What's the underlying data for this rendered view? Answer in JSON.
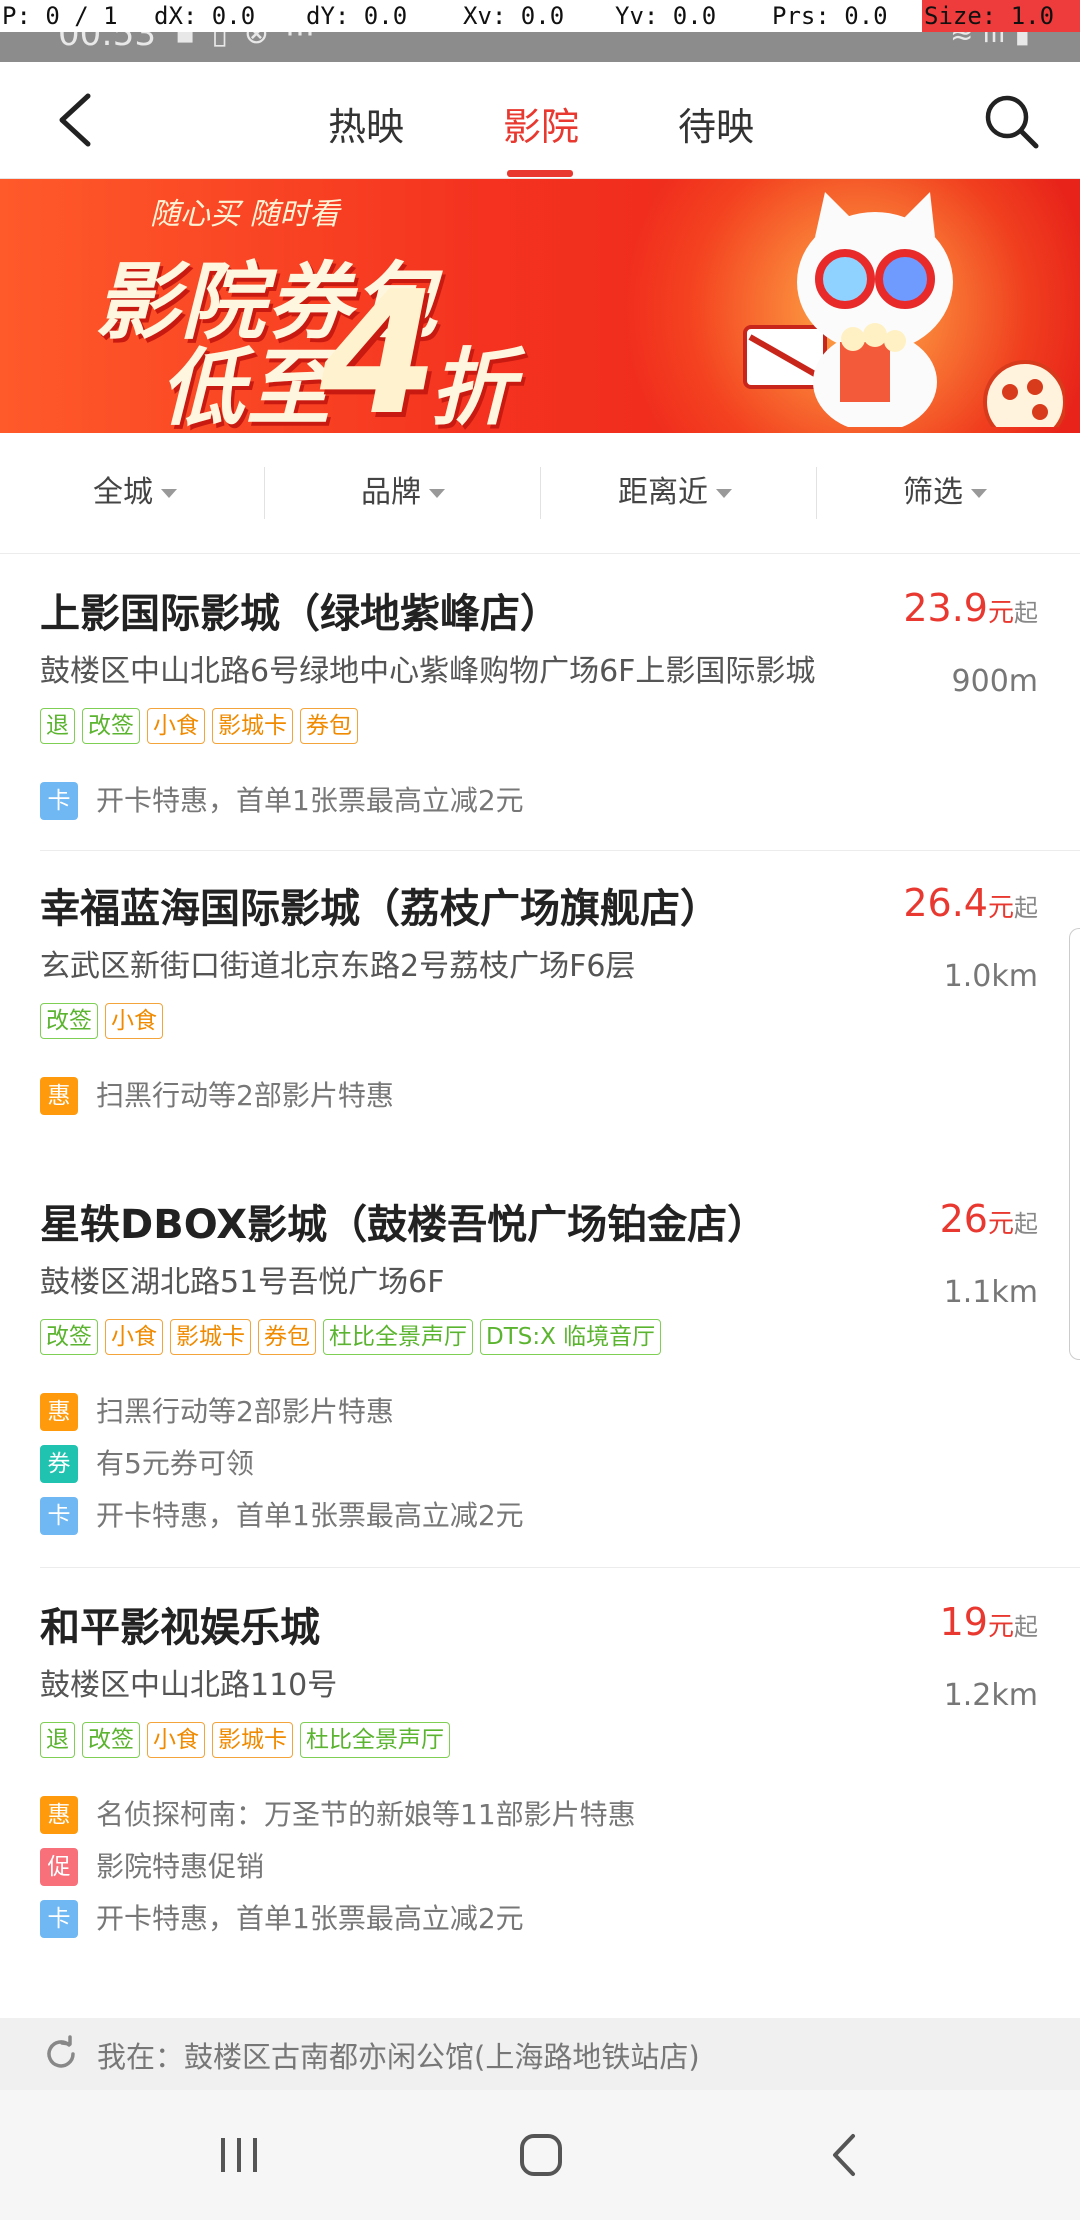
{
  "debug": {
    "p": "P: 0 / 1",
    "dx": "dX: 0.0",
    "dy": "dY: 0.0",
    "xv": "Xv: 0.0",
    "yv": "Yv: 0.0",
    "prs": "Prs: 0.0",
    "size": "Size: 1.0"
  },
  "status": {
    "time": "00:53"
  },
  "header": {
    "tabs": [
      {
        "label": "热映"
      },
      {
        "label": "影院"
      },
      {
        "label": "待映"
      }
    ],
    "active_tab": "影院"
  },
  "banner": {
    "slogan": "随心买  随时看",
    "line1": "影院券包",
    "line2": "低至",
    "number": "4",
    "suffix": "折"
  },
  "filters": [
    {
      "label": "全城"
    },
    {
      "label": "品牌"
    },
    {
      "label": "距离近"
    },
    {
      "label": "筛选"
    }
  ],
  "cinemas": [
    {
      "name": "上影国际影城（绿地紫峰店）",
      "price": "23.9",
      "unit": "元",
      "from": "起",
      "address": "鼓楼区中山北路6号绿地中心紫峰购物广场6F上影国际影城",
      "distance": "900m",
      "tags": [
        "退",
        "改签",
        "小食",
        "影城卡",
        "券包"
      ],
      "promos": [
        {
          "icon": "卡",
          "text": "开卡特惠，首单1张票最高立减2元"
        }
      ]
    },
    {
      "name": "幸福蓝海国际影城（荔枝广场旗舰店）",
      "price": "26.4",
      "unit": "元",
      "from": "起",
      "address": "玄武区新街口街道北京东路2号荔枝广场F6层",
      "distance": "1.0km",
      "tags": [
        "改签",
        "小食"
      ],
      "promos": [
        {
          "icon": "惠",
          "text": "扫黑行动等2部影片特惠"
        }
      ]
    },
    {
      "name": "星轶DBOX影城（鼓楼吾悦广场铂金店）",
      "price": "26",
      "unit": "元",
      "from": "起",
      "address": "鼓楼区湖北路51号吾悦广场6F",
      "distance": "1.1km",
      "tags": [
        "改签",
        "小食",
        "影城卡",
        "券包",
        "杜比全景声厅",
        "DTS:X 临境音厅"
      ],
      "promos": [
        {
          "icon": "惠",
          "text": "扫黑行动等2部影片特惠"
        },
        {
          "icon": "券",
          "text": "有5元券可领"
        },
        {
          "icon": "卡",
          "text": "开卡特惠，首单1张票最高立减2元"
        }
      ]
    },
    {
      "name": "和平影视娱乐城",
      "price": "19",
      "unit": "元",
      "from": "起",
      "address": "鼓楼区中山北路110号",
      "distance": "1.2km",
      "tags": [
        "退",
        "改签",
        "小食",
        "影城卡",
        "杜比全景声厅"
      ],
      "promos": [
        {
          "icon": "惠",
          "text": "名侦探柯南：万圣节的新娘等11部影片特惠"
        },
        {
          "icon": "促",
          "text": "影院特惠促销"
        },
        {
          "icon": "卡",
          "text": "开卡特惠，首单1张票最高立减2元"
        }
      ]
    }
  ],
  "location": {
    "text": "我在：鼓楼区古南都亦闲公馆(上海路地铁站店)"
  },
  "colors": {
    "accent": "#e8382f",
    "tag_green": "#5bb42f",
    "tag_orange": "#f08a00"
  }
}
